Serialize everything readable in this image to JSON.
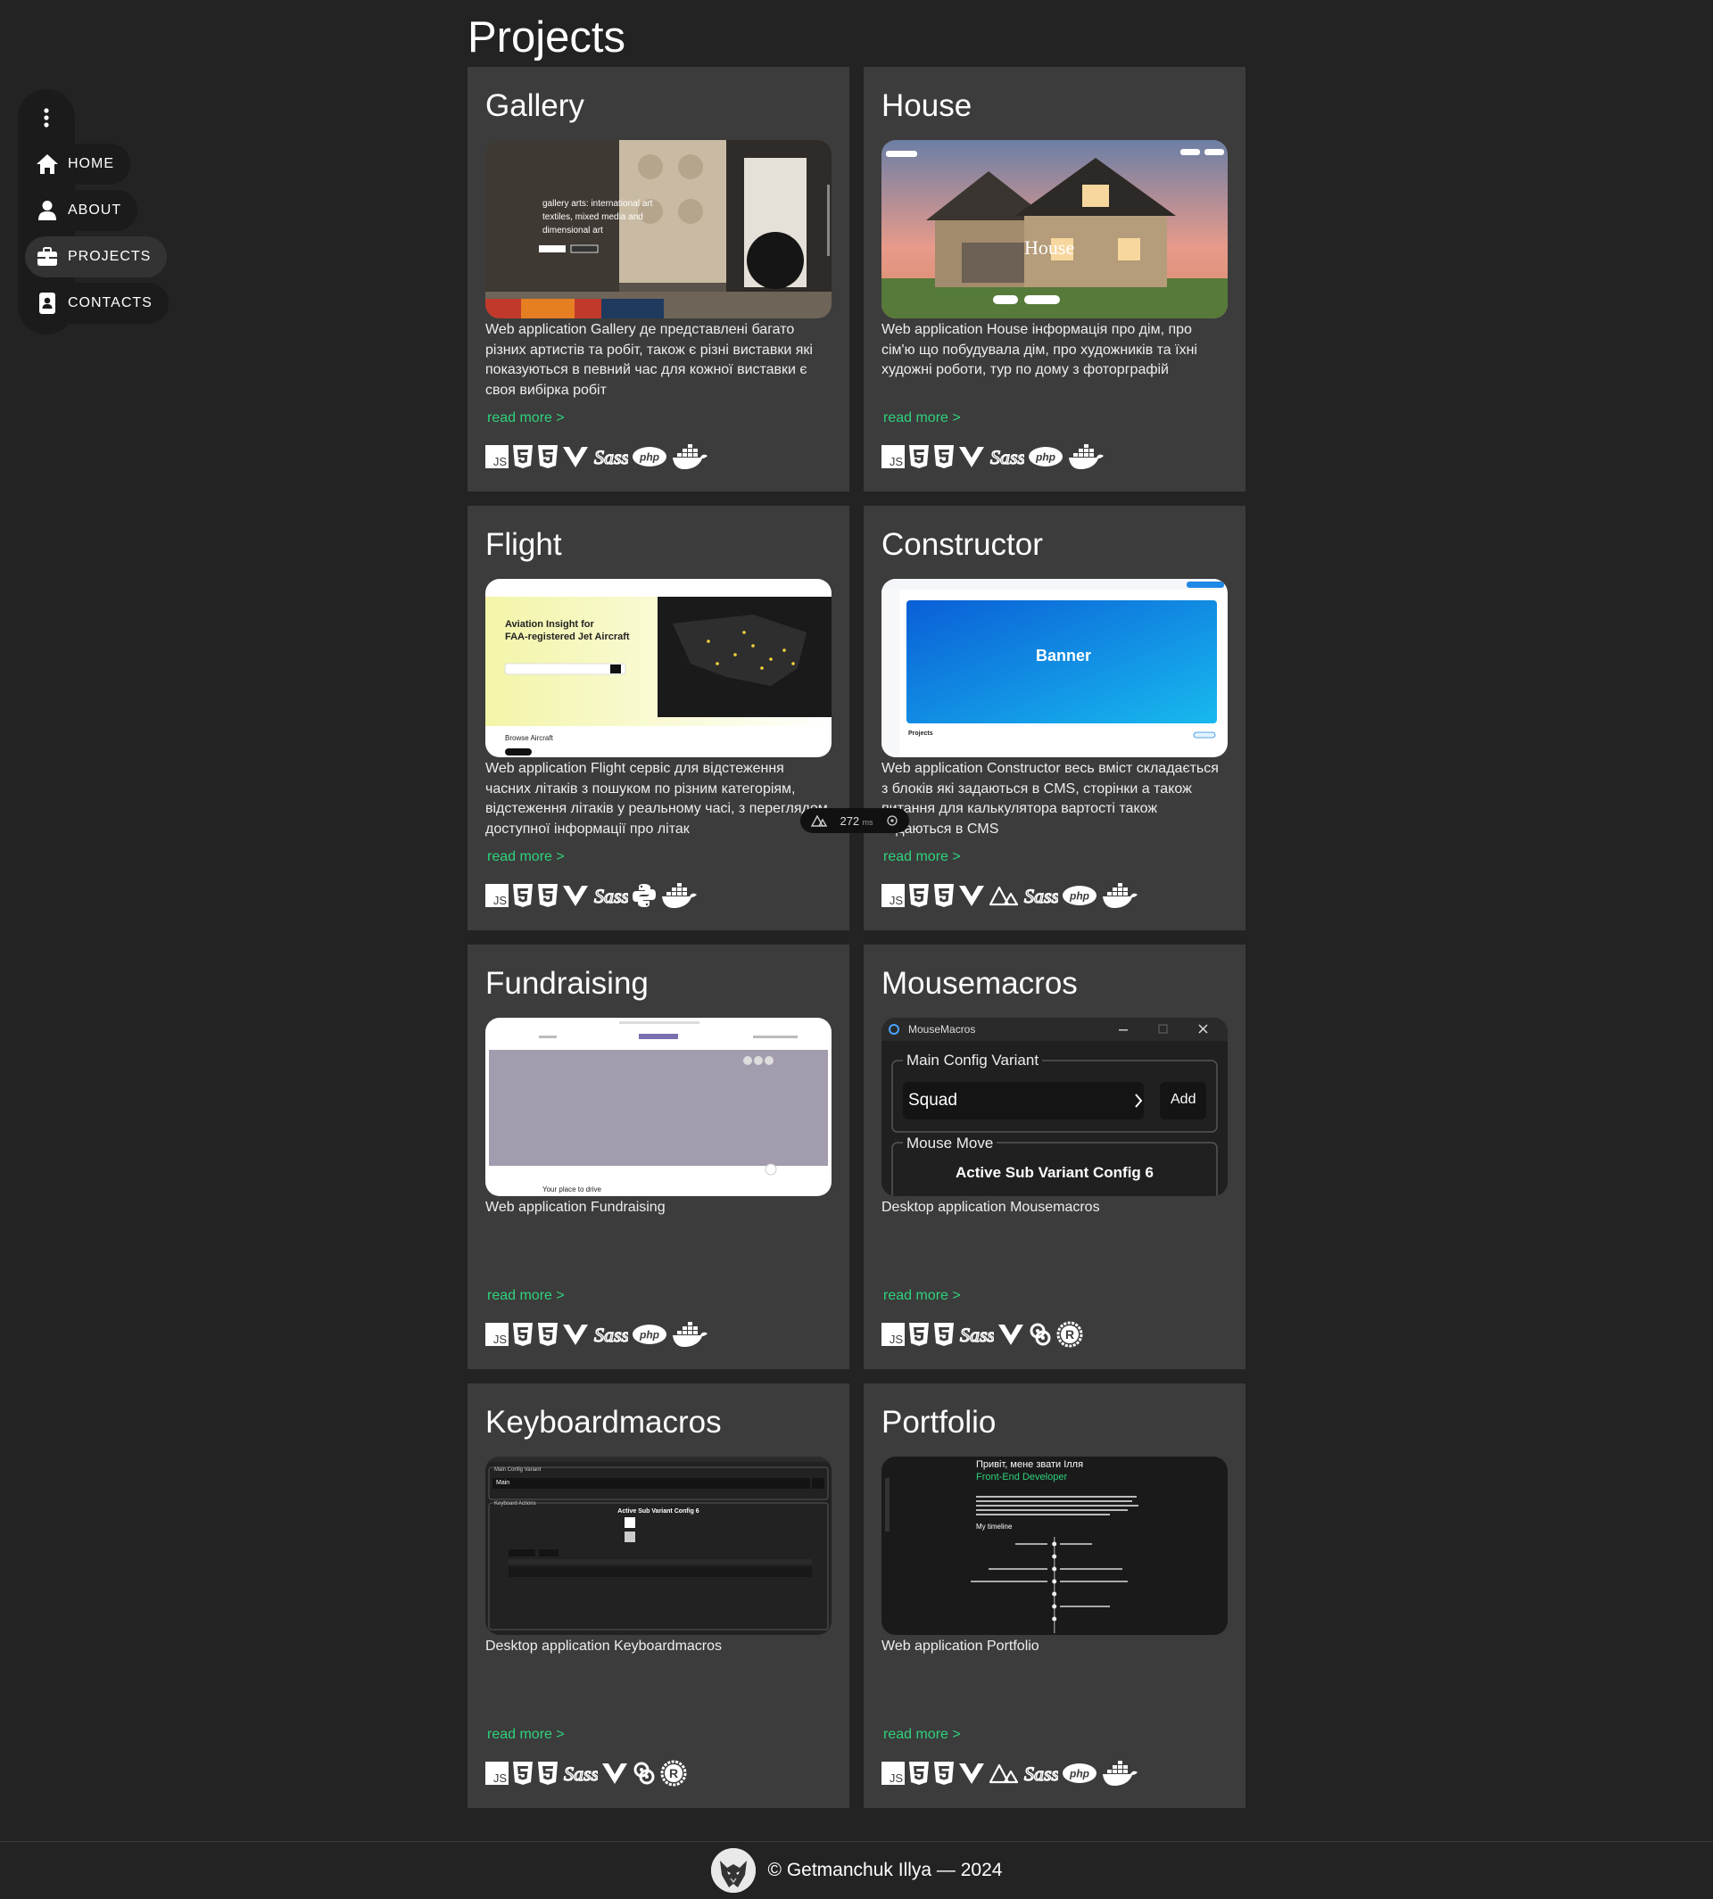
{
  "page": {
    "title": "Projects"
  },
  "nav": {
    "items": [
      {
        "label": "HOME",
        "icon": "home-icon"
      },
      {
        "label": "ABOUT",
        "icon": "user-icon"
      },
      {
        "label": "PROJECTS",
        "icon": "briefcase-icon",
        "active": true
      },
      {
        "label": "CONTACTS",
        "icon": "contact-card-icon"
      }
    ]
  },
  "projects": [
    {
      "title": "Gallery",
      "description": "Web application Gallery де представлені багато різних артистів та робіт, також є різні виставки які показуються в певний час для кожної виставки є своя вибірка робіт",
      "read_more": "read more >",
      "image_text": [
        "gallery arts: international art",
        "textiles, mixed media and",
        "dimensional art"
      ],
      "tech": [
        "javascript-icon",
        "html5-icon",
        "css3-icon",
        "vue-icon",
        "sass-icon",
        "php-icon",
        "docker-icon"
      ]
    },
    {
      "title": "House",
      "description": "Web application House інформація про дім, про сім'ю що побудувала дім, про художників та їхні художні роботи, тур по дому з фоторграфій",
      "read_more": "read more >",
      "image_text": [
        "House"
      ],
      "tech": [
        "javascript-icon",
        "html5-icon",
        "css3-icon",
        "vue-icon",
        "sass-icon",
        "php-icon",
        "docker-icon"
      ]
    },
    {
      "title": "Flight",
      "description": "Web application Flight сервіс для відстеження часних літаків з пошуком по різним категоріям, відстеження літаків у реальному часі, з переглядом доступної інформації про літак",
      "read_more": "read more >",
      "image_text": [
        "Aviation Insight for",
        "FAA-registered Jet Aircraft",
        "Browse Aircraft"
      ],
      "tech": [
        "javascript-icon",
        "html5-icon",
        "css3-icon",
        "vue-icon",
        "sass-icon",
        "python-icon",
        "docker-icon"
      ]
    },
    {
      "title": "Constructor",
      "description": "Web application Constructor весь вміст складається з блоків які задаються в CMS, сторінки а також питання для калькулятора вартості також задаються в CMS",
      "read_more": "read more >",
      "image_text": [
        "Banner",
        "Projects"
      ],
      "tech": [
        "javascript-icon",
        "html5-icon",
        "css3-icon",
        "vue-icon",
        "nuxt-icon",
        "sass-icon",
        "php-icon",
        "docker-icon"
      ]
    },
    {
      "title": "Fundraising",
      "description": "Web application Fundraising",
      "read_more": "read more >",
      "image_text": [
        "Your place to drive"
      ],
      "tech": [
        "javascript-icon",
        "html5-icon",
        "css3-icon",
        "vue-icon",
        "sass-icon",
        "php-icon",
        "docker-icon"
      ]
    },
    {
      "title": "Mousemacros",
      "description": "Desktop application Mousemacros",
      "read_more": "read more >",
      "image_text": [
        "MouseMacros",
        "Main Config Variant",
        "Squad",
        "Add",
        "Mouse Move",
        "Active Sub Variant Config 6"
      ],
      "tech": [
        "javascript-icon",
        "html5-icon",
        "css3-icon",
        "sass-icon",
        "vue-icon",
        "tauri-icon",
        "rust-icon"
      ]
    },
    {
      "title": "Keyboardmacros",
      "description": "Desktop application Keyboardmacros",
      "read_more": "read more >",
      "image_text": [
        "Main Config Variant",
        "Main",
        "Keyboard Actions",
        "Active Sub Variant Config 6"
      ],
      "tech": [
        "javascript-icon",
        "html5-icon",
        "css3-icon",
        "sass-icon",
        "vue-icon",
        "tauri-icon",
        "rust-icon"
      ]
    },
    {
      "title": "Portfolio",
      "description": "Web application Portfolio",
      "read_more": "read more >",
      "image_text": [
        "Привіт, мене звати Ілля",
        "Front-End Developer",
        "My timeline"
      ],
      "tech": [
        "javascript-icon",
        "html5-icon",
        "css3-icon",
        "vue-icon",
        "nuxt-icon",
        "sass-icon",
        "php-icon",
        "docker-icon"
      ]
    }
  ],
  "perf_badge": {
    "value": "272",
    "unit": "ms"
  },
  "footer": {
    "text": "© Getmanchuk Illya — 2024"
  },
  "colors": {
    "background": "#232323",
    "card": "#3c3c3c",
    "accent": "#2fd27c",
    "sidebar": "#1b1b1b"
  }
}
